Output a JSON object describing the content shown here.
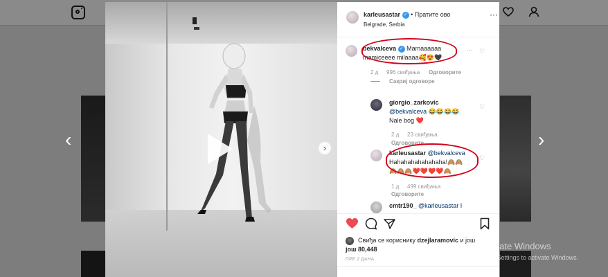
{
  "post": {
    "username": "karleusastar",
    "follow_label": "• Пратите ово",
    "location": "Belgrade, Serbia"
  },
  "comments": [
    {
      "username": "bekvalceva",
      "text1": "Mamaaaaaa",
      "text2": "mamiceeee milaaaa🥰😍🖤",
      "age": "2 д",
      "likes": "996 свиђања",
      "reply": "Одговорите",
      "hide": "Сакриј одговоре"
    },
    {
      "username": "giorgio_zarkovic",
      "text1": "@bekvalceva 😂😂😂😂",
      "text2": "Nale bog ❤️",
      "age": "2 д",
      "likes": "23 свиђања",
      "reply": "Одговорите"
    },
    {
      "username": "karleusastar",
      "text1": "@bekvalceva",
      "text2": "Hahahahahahahaha!🙈🙈",
      "text3": "🙈🙈🙈❤️❤️❤️❤️🙈",
      "age": "1 д",
      "likes": "499 свиђања",
      "reply": "Одговорите"
    },
    {
      "username": "cmtr190_",
      "text1": "@karleusastar I"
    }
  ],
  "likes": {
    "line1": "Свиђа се кориснику",
    "user": "dzejlaramovic",
    "and": "и још",
    "count": "80,448",
    "ago": "ПРЕ 2 ДАНА"
  },
  "watermark": {
    "title": "Activate Windows",
    "subtitle": "Go to Settings to activate Windows."
  },
  "icons": {
    "instagram": "instagram-icon",
    "explore": "compass-icon",
    "activity": "heart-icon",
    "profile": "profile-icon"
  },
  "colors": {
    "like_red": "#ed4956",
    "verified_blue": "#3897f0",
    "annotation_red": "#d0021b"
  }
}
